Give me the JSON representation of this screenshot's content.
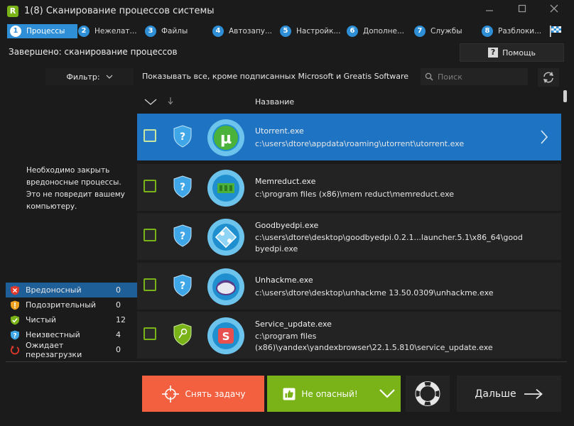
{
  "window": {
    "title": "1(8) Сканирование процессов системы",
    "logo_letter": "R"
  },
  "steps": [
    {
      "num": "1",
      "label": "Процессы"
    },
    {
      "num": "2",
      "label": "Нежелат..."
    },
    {
      "num": "3",
      "label": "Файлы"
    },
    {
      "num": "4",
      "label": "Автозапу..."
    },
    {
      "num": "5",
      "label": "Настройк..."
    },
    {
      "num": "6",
      "label": "Дополне..."
    },
    {
      "num": "7",
      "label": "Службы"
    },
    {
      "num": "8",
      "label": "Разблоки..."
    }
  ],
  "status": "Завершено: сканирование процессов",
  "help": {
    "icon": "?",
    "label": "Помощь"
  },
  "filter": {
    "label": "Фильтр:",
    "description": "Показывать все, кроме подписанных Microsoft и Greatis Software"
  },
  "search": {
    "placeholder": "Поиск"
  },
  "left_message": "Необходимо закрыть\nвредоносные процессы.\nЭто не повредит вашему\nкомпьютеру.",
  "legend": [
    {
      "label": "Вредоносный",
      "count": "0"
    },
    {
      "label": "Подозрительный",
      "count": "0"
    },
    {
      "label": "Чистый",
      "count": "12"
    },
    {
      "label": "Неизвестный",
      "count": "4"
    },
    {
      "label": "Ожидает перезагрузки",
      "count": "0"
    }
  ],
  "list": {
    "column_name": "Название",
    "rows": [
      {
        "name": "Utorrent.exe",
        "path": "c:\\users\\dtore\\appdata\\roaming\\utorrent\\utorrent.exe"
      },
      {
        "name": "Memreduct.exe",
        "path": "c:\\program files (x86)\\mem reduct\\memreduct.exe"
      },
      {
        "name": "Goodbyedpi.exe",
        "path": "c:\\users\\dtore\\desktop\\goodbyedpi.0.2.1...launcher.5.1\\x86_64\\goodbyedpi.exe"
      },
      {
        "name": "Unhackme.exe",
        "path": "c:\\users\\dtore\\desktop\\unhackme 13.50.0309\\unhackme.exe"
      },
      {
        "name": "Service_update.exe",
        "path": "c:\\program files (x86)\\yandex\\yandexbrowser\\22.1.5.810\\service_update.exe"
      }
    ]
  },
  "buttons": {
    "kill": "Снять задачу",
    "safe": "Не опасный!",
    "next": "Дальше"
  },
  "colors": {
    "accent_blue": "#1e74c2",
    "step_blue": "#2e8fd6",
    "green": "#7ab317",
    "orange": "#f2603f"
  }
}
